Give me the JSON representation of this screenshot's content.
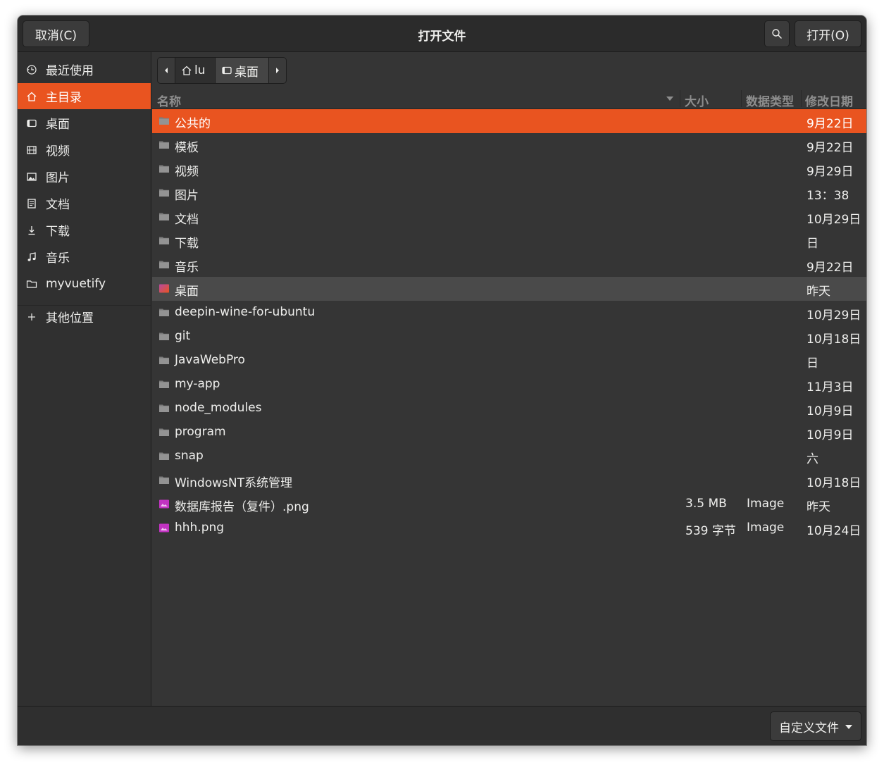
{
  "header": {
    "cancel_label": "取消(C)",
    "title": "打开文件",
    "open_label": "打开(O)",
    "search_icon": "search-icon"
  },
  "sidebar": {
    "items": [
      {
        "label": "最近使用",
        "icon": "clock-icon"
      },
      {
        "label": "主目录",
        "icon": "home-icon",
        "active": true
      },
      {
        "label": "桌面",
        "icon": "desktop-icon"
      },
      {
        "label": "视频",
        "icon": "film-icon"
      },
      {
        "label": "图片",
        "icon": "image-icon"
      },
      {
        "label": "文档",
        "icon": "document-icon"
      },
      {
        "label": "下载",
        "icon": "download-icon"
      },
      {
        "label": "音乐",
        "icon": "music-icon"
      },
      {
        "label": "myvuetify",
        "icon": "folder-icon"
      }
    ],
    "other_locations": "其他位置"
  },
  "pathbar": {
    "home_label": "lu",
    "current_label": "桌面"
  },
  "columns": {
    "name": "名称",
    "size": "大小",
    "type": "数据类型",
    "modified": "修改日期"
  },
  "files": [
    {
      "name": "公共的",
      "size": "",
      "type": "",
      "date": "9月22日",
      "kind": "folder"
    },
    {
      "name": "模板",
      "size": "",
      "type": "",
      "date": "9月22日",
      "kind": "folder"
    },
    {
      "name": "视频",
      "size": "",
      "type": "",
      "date": "9月29日",
      "kind": "folder"
    },
    {
      "name": "图片",
      "size": "",
      "type": "",
      "date": "13：38",
      "kind": "folder"
    },
    {
      "name": "文档",
      "size": "",
      "type": "",
      "date": "10月29日",
      "kind": "folder"
    },
    {
      "name": "下载",
      "size": "",
      "type": "",
      "date": "日",
      "kind": "folder"
    },
    {
      "name": "音乐",
      "size": "",
      "type": "",
      "date": "9月22日",
      "kind": "folder"
    },
    {
      "name": "桌面",
      "size": "",
      "type": "",
      "date": "昨天",
      "kind": "desktop"
    },
    {
      "name": "deepin-wine-for-ubuntu",
      "size": "",
      "type": "",
      "date": "10月29日",
      "kind": "folder"
    },
    {
      "name": "git",
      "size": "",
      "type": "",
      "date": "10月18日",
      "kind": "folder"
    },
    {
      "name": "JavaWebPro",
      "size": "",
      "type": "",
      "date": "日",
      "kind": "folder"
    },
    {
      "name": "my-app",
      "size": "",
      "type": "",
      "date": "11月3日",
      "kind": "folder"
    },
    {
      "name": "node_modules",
      "size": "",
      "type": "",
      "date": "10月9日",
      "kind": "folder"
    },
    {
      "name": "program",
      "size": "",
      "type": "",
      "date": "10月9日",
      "kind": "folder"
    },
    {
      "name": "snap",
      "size": "",
      "type": "",
      "date": "六",
      "kind": "folder"
    },
    {
      "name": "WindowsNT系统管理",
      "size": "",
      "type": "",
      "date": "10月18日",
      "kind": "folder"
    },
    {
      "name": "数据库报告（复件）.png",
      "size": "3.5 MB",
      "type": "Image",
      "date": "昨天",
      "kind": "image"
    },
    {
      "name": "hhh.png",
      "size": "539 字节",
      "type": "Image",
      "date": "10月24日",
      "kind": "image"
    }
  ],
  "footer": {
    "filter_label": "自定义文件"
  },
  "colors": {
    "accent": "#e95420",
    "background": "#353535",
    "headerbar": "#2b2b2b"
  }
}
